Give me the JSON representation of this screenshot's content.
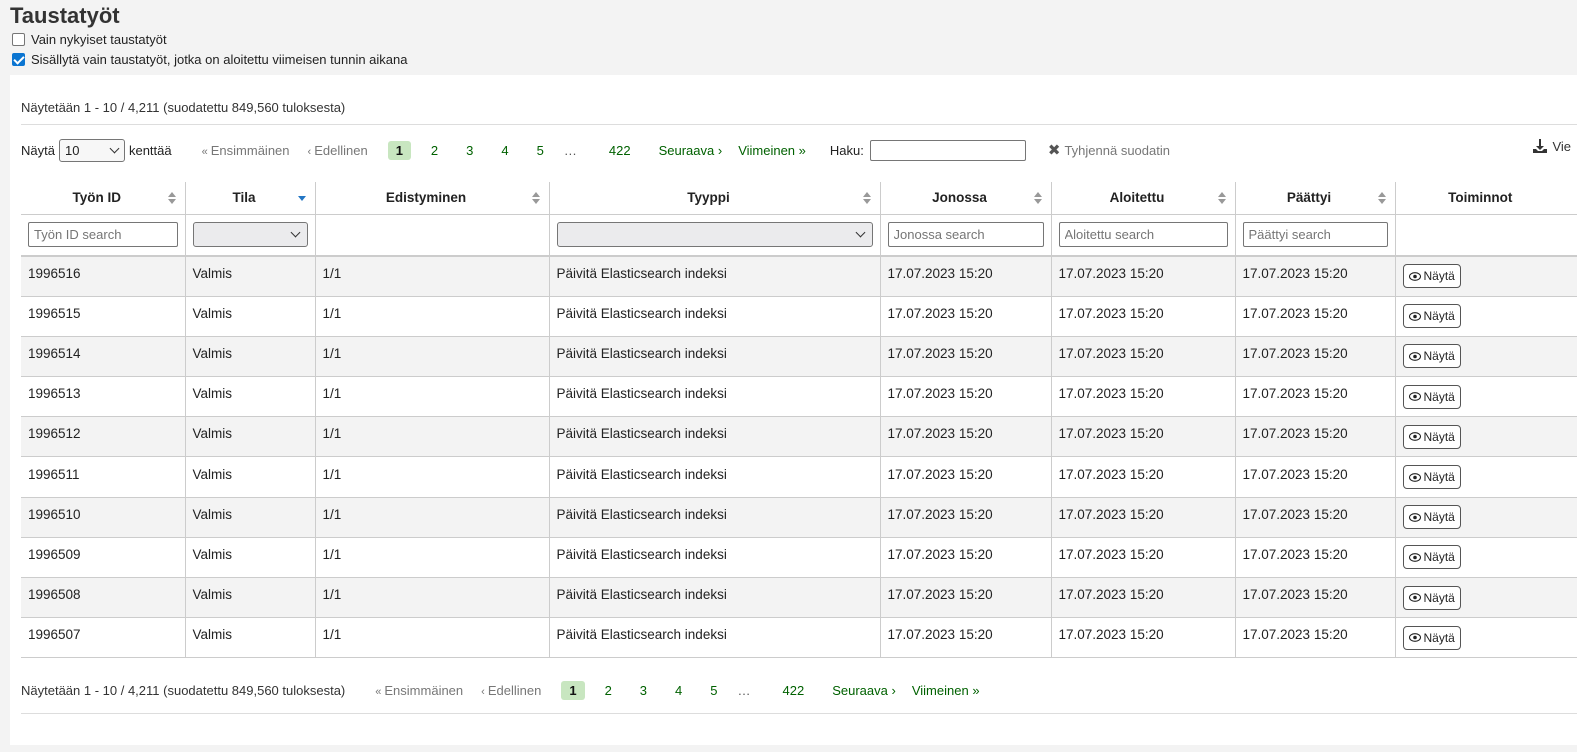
{
  "page": {
    "title": "Taustatyöt"
  },
  "filters": {
    "only_current": {
      "label": "Vain nykyiset taustatyöt",
      "checked": false
    },
    "last_hour": {
      "label": "Sisällytä vain taustatyöt, jotka on aloitettu viimeisen tunnin aikana",
      "checked": true
    }
  },
  "info_top": "Näytetään 1 - 10 / 4,211 (suodatettu 849,560 tuloksesta)",
  "info_bottom": "Näytetään 1 - 10 / 4,211 (suodatettu 849,560 tuloksesta)",
  "length": {
    "prefix": "Näytä",
    "value": "10",
    "suffix": "kenttää"
  },
  "pager": {
    "first": "Ensimmäinen",
    "prev": "Edellinen",
    "pages": [
      "1",
      "2",
      "3",
      "4",
      "5"
    ],
    "dots": "…",
    "last_page": "422",
    "next": "Seuraava",
    "last": "Viimeinen"
  },
  "search": {
    "label": "Haku:"
  },
  "clear_filter": "Tyhjennä suodatin",
  "export": "Vie",
  "columns": [
    "Työn ID",
    "Tila",
    "Edistyminen",
    "Tyyppi",
    "Jonossa",
    "Aloitettu",
    "Päättyi",
    "Toiminnot"
  ],
  "column_filters": {
    "id": "Työn ID search",
    "enqueued": "Jonossa search",
    "started": "Aloitettu search",
    "ended": "Päättyi search"
  },
  "rows": [
    {
      "id": "1996516",
      "status": "Valmis",
      "progress": "1/1",
      "type": "Päivitä Elasticsearch indeksi",
      "enqueued": "17.07.2023 15:20",
      "started": "17.07.2023 15:20",
      "ended": "17.07.2023 15:20",
      "action": "Näytä"
    },
    {
      "id": "1996515",
      "status": "Valmis",
      "progress": "1/1",
      "type": "Päivitä Elasticsearch indeksi",
      "enqueued": "17.07.2023 15:20",
      "started": "17.07.2023 15:20",
      "ended": "17.07.2023 15:20",
      "action": "Näytä"
    },
    {
      "id": "1996514",
      "status": "Valmis",
      "progress": "1/1",
      "type": "Päivitä Elasticsearch indeksi",
      "enqueued": "17.07.2023 15:20",
      "started": "17.07.2023 15:20",
      "ended": "17.07.2023 15:20",
      "action": "Näytä"
    },
    {
      "id": "1996513",
      "status": "Valmis",
      "progress": "1/1",
      "type": "Päivitä Elasticsearch indeksi",
      "enqueued": "17.07.2023 15:20",
      "started": "17.07.2023 15:20",
      "ended": "17.07.2023 15:20",
      "action": "Näytä"
    },
    {
      "id": "1996512",
      "status": "Valmis",
      "progress": "1/1",
      "type": "Päivitä Elasticsearch indeksi",
      "enqueued": "17.07.2023 15:20",
      "started": "17.07.2023 15:20",
      "ended": "17.07.2023 15:20",
      "action": "Näytä"
    },
    {
      "id": "1996511",
      "status": "Valmis",
      "progress": "1/1",
      "type": "Päivitä Elasticsearch indeksi",
      "enqueued": "17.07.2023 15:20",
      "started": "17.07.2023 15:20",
      "ended": "17.07.2023 15:20",
      "action": "Näytä"
    },
    {
      "id": "1996510",
      "status": "Valmis",
      "progress": "1/1",
      "type": "Päivitä Elasticsearch indeksi",
      "enqueued": "17.07.2023 15:20",
      "started": "17.07.2023 15:20",
      "ended": "17.07.2023 15:20",
      "action": "Näytä"
    },
    {
      "id": "1996509",
      "status": "Valmis",
      "progress": "1/1",
      "type": "Päivitä Elasticsearch indeksi",
      "enqueued": "17.07.2023 15:20",
      "started": "17.07.2023 15:20",
      "ended": "17.07.2023 15:20",
      "action": "Näytä"
    },
    {
      "id": "1996508",
      "status": "Valmis",
      "progress": "1/1",
      "type": "Päivitä Elasticsearch indeksi",
      "enqueued": "17.07.2023 15:20",
      "started": "17.07.2023 15:20",
      "ended": "17.07.2023 15:20",
      "action": "Näytä"
    },
    {
      "id": "1996507",
      "status": "Valmis",
      "progress": "1/1",
      "type": "Päivitä Elasticsearch indeksi",
      "enqueued": "17.07.2023 15:20",
      "started": "17.07.2023 15:20",
      "ended": "17.07.2023 15:20",
      "action": "Näytä"
    }
  ],
  "icons": {
    "sort": "sort-icon",
    "eye": "eye-icon",
    "download": "download-icon",
    "clear": "close-icon"
  }
}
